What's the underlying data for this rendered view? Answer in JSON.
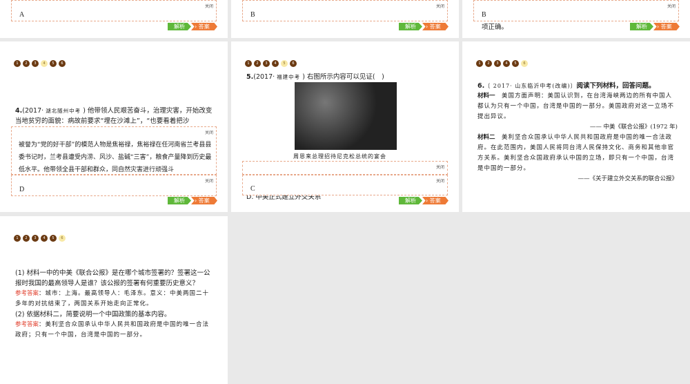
{
  "common": {
    "close": "关闭",
    "analysis": "解析",
    "answer": "答案",
    "dots": [
      "1",
      "2",
      "3",
      "4",
      "5",
      "6"
    ]
  },
  "top": [
    {
      "answer": "A"
    },
    {
      "answer": "B"
    },
    {
      "answer": "B",
      "tail": "项正确。"
    }
  ],
  "q4": {
    "num": "4.",
    "src_a": "(2017· ",
    "src_b": "湖北随州中考",
    "src_c": " )",
    "text": " 他带领人民艰苦奋斗，治理灾害，开始改变当地贫穷的面貌：病故前要求“埋在沙滩上”，“也要看着把沙",
    "explanation": "被誉为“党的好干部”的模范人物是焦裕禄，焦裕禄在任河南省兰考县县委书记时，兰考县遭受内涝、风沙、盐碱“三害”，粮食产量降到历史最低水平。他带领全县干部和群众，同自然灾害进行顽强斗",
    "answer": "D"
  },
  "q5": {
    "num": "5.",
    "src_a": "(2017· ",
    "src_b": "福建中考",
    "src_c": " )",
    "text": " 右图所示内容可以见证(　)",
    "caption": "周恩来总理招待尼克松总统的宴会",
    "option_d": "D. 中美正式建立外交关系",
    "answer": "C"
  },
  "q6": {
    "num": "6.",
    "src": "〔 2017· 山东临沂中考(改编)〕",
    "text": "阅读下列材料，回答问题。",
    "m1_label": "材料一",
    "m1": "　美国方面声明：美国认识到，在台湾海峡两边的所有中国人都认为只有一个中国，台湾是中国的一部分。美国政府对这一立场不提出异议。",
    "m1_src": "—— 中美《联合公报》(1972 年)",
    "m2_label": "材料二",
    "m2": "　美利坚合众国承认中华人民共和国政府是中国的唯一合法政府。在此范围内，美国人民将同台湾人民保持文化、商务和其他非官方关系。美利坚合众国政府承认中国的立场，即只有一个中国，台湾是中国的一部分。",
    "m2_src": "——《关于建立外交关系的联合公报》"
  },
  "q6b": {
    "q1": "(1) 材料一中的中美《联合公报》是在哪个城市签署的？签署这一公报时我国的最高领导人是谁？该公报的签署有何重要历史意义？",
    "ref": "参考答案",
    "a1": "：城市：上海。最高领导人：毛泽东。意义：中美两国二十多年的对抗结束了，两国关系开始走向正常化。",
    "q2": "(2) 依据材料二，简要说明一个中国政策的基本内容。",
    "a2": "：美利坚合众国承认中华人民共和国政府是中国的唯一合法政府；只有一个中国，台湾是中国的一部分。"
  }
}
